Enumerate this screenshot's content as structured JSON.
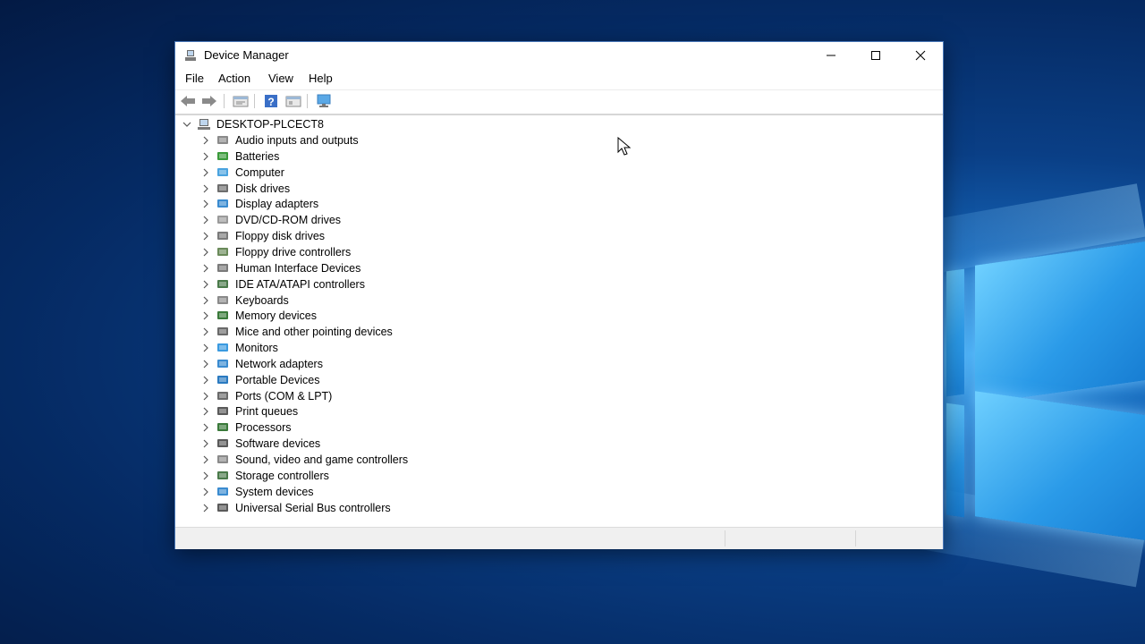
{
  "window": {
    "title": "Device Manager",
    "controls": {
      "minimize": "minimize-icon",
      "maximize": "maximize-icon",
      "close": "close-icon"
    }
  },
  "menu": [
    "File",
    "Action",
    "View",
    "Help"
  ],
  "toolbar": [
    "back-arrow-icon",
    "forward-arrow-icon",
    "properties-icon",
    "help-icon",
    "action-view-icon",
    "monitor-scan-icon"
  ],
  "tree": {
    "root": "DESKTOP-PLCECT8",
    "items": [
      {
        "label": "Audio inputs and outputs",
        "icon": "speaker-icon"
      },
      {
        "label": "Batteries",
        "icon": "battery-icon"
      },
      {
        "label": "Computer",
        "icon": "computer-icon"
      },
      {
        "label": "Disk drives",
        "icon": "disk-drive-icon"
      },
      {
        "label": "Display adapters",
        "icon": "display-adapter-icon"
      },
      {
        "label": "DVD/CD-ROM drives",
        "icon": "dvd-icon"
      },
      {
        "label": "Floppy disk drives",
        "icon": "floppy-disk-icon"
      },
      {
        "label": "Floppy drive controllers",
        "icon": "floppy-controller-icon"
      },
      {
        "label": "Human Interface Devices",
        "icon": "hid-icon"
      },
      {
        "label": "IDE ATA/ATAPI controllers",
        "icon": "ide-controller-icon"
      },
      {
        "label": "Keyboards",
        "icon": "keyboard-icon"
      },
      {
        "label": "Memory devices",
        "icon": "memory-icon"
      },
      {
        "label": "Mice and other pointing devices",
        "icon": "mouse-icon"
      },
      {
        "label": "Monitors",
        "icon": "monitor-icon"
      },
      {
        "label": "Network adapters",
        "icon": "network-adapter-icon"
      },
      {
        "label": "Portable Devices",
        "icon": "portable-device-icon"
      },
      {
        "label": "Ports (COM & LPT)",
        "icon": "port-icon"
      },
      {
        "label": "Print queues",
        "icon": "printer-icon"
      },
      {
        "label": "Processors",
        "icon": "processor-icon"
      },
      {
        "label": "Software devices",
        "icon": "software-device-icon"
      },
      {
        "label": "Sound, video and game controllers",
        "icon": "sound-controller-icon"
      },
      {
        "label": "Storage controllers",
        "icon": "storage-controller-icon"
      },
      {
        "label": "System devices",
        "icon": "system-device-icon"
      },
      {
        "label": "Universal Serial Bus controllers",
        "icon": "usb-icon"
      }
    ]
  },
  "colors": {
    "accent": "#1e7fd8",
    "desktop": "#0a3f86"
  }
}
